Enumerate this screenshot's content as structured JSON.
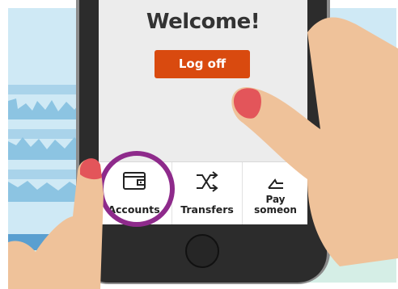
{
  "screen": {
    "title": "Welcome!",
    "logoff_label": "Log off"
  },
  "tabbar": {
    "items": [
      {
        "label": "Accounts",
        "icon": "wallet-icon"
      },
      {
        "label": "Transfers",
        "icon": "shuffle-icon"
      },
      {
        "label_line1": "Pay",
        "label_line2": "someon",
        "icon": "pay-icon"
      }
    ]
  },
  "colors": {
    "logoff_button": "#d94a0f",
    "highlight_ring": "#8e2a8b",
    "skin": "#efc29a",
    "nail": "#e3555a",
    "sky": "#cfe9f5",
    "phone_body": "#2c2c2c"
  }
}
